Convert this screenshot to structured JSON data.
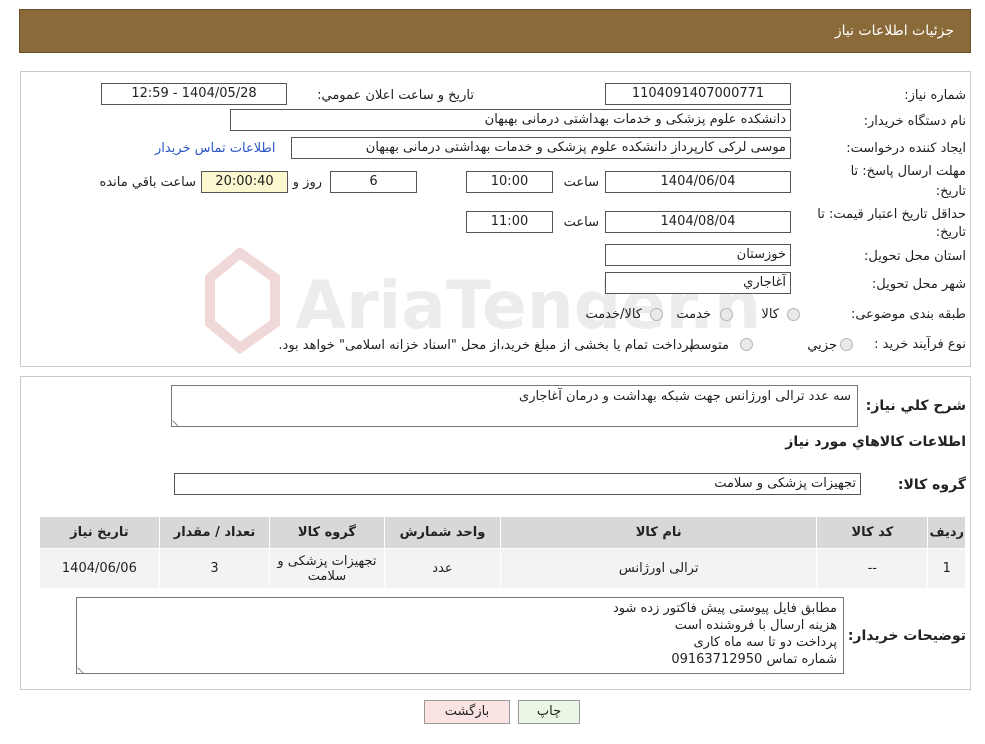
{
  "header": {
    "title": "جزئیات اطلاعات نیاز"
  },
  "info": {
    "need_number_label": "شماره نیاز:",
    "need_number": "1104091407000771",
    "announce_label": "تاريخ و ساعت اعلان عمومي:",
    "announce_value": "1404/05/28 - 12:59",
    "buyer_org_label": "نام دستگاه خريدار:",
    "buyer_org": "دانشکده علوم پزشکی و خدمات بهداشتی  درمانی بهبهان",
    "creator_label": "ايجاد کننده درخواست:",
    "creator": "موسی لرکی کارپرداز دانشکده علوم پزشکی و خدمات بهداشتی  درمانی بهبهان",
    "contact_link": "اطلاعات تماس خريدار",
    "reply_deadline_label_1": "مهلت ارسال پاسخ: تا",
    "reply_deadline_label_2": "تاريخ:",
    "reply_date": "1404/06/04",
    "time_label": "ساعت",
    "reply_time": "10:00",
    "days_value": "6",
    "days_label": "روز و",
    "remaining_time": "20:00:40",
    "remaining_label": "ساعت باقي مانده",
    "price_validity_label_1": "حداقل تاريخ اعتبار قيمت: تا",
    "price_validity_label_2": "تاريخ:",
    "price_date": "1404/08/04",
    "price_time": "11:00",
    "province_label": "استان محل تحويل:",
    "province": "خوزستان",
    "city_label": "شهر محل تحويل:",
    "city": "آغاجاري",
    "category_label": "طبقه بندی موضوعی:",
    "category_options": [
      "کالا",
      "خدمت",
      "کالا/خدمت"
    ],
    "process_label": "نوع فرآيند خريد :",
    "process_options": [
      "جزيي",
      "متوسط"
    ],
    "process_note": "پرداخت تمام يا بخشی از مبلغ خريد،از محل \"اسناد خزانه اسلامی\" خواهد بود."
  },
  "details": {
    "description_label": "شرح کلي نياز:",
    "description": "سه عدد ترالی اورژانس جهت شبکه بهداشت و درمان آغاجاری",
    "goods_info_title": "اطلاعات کالاهاي مورد نياز",
    "goods_group_label": "گروه کالا:",
    "goods_group": "تجهیزات پزشکی و سلامت",
    "table": {
      "headers": [
        "رديف",
        "کد کالا",
        "نام کالا",
        "واحد شمارش",
        "گروه کالا",
        "تعداد / مقدار",
        "تاريخ نياز"
      ],
      "rows": [
        [
          "1",
          "--",
          "ترالی اورژانس",
          "عدد",
          "تجهیزات پزشکی و سلامت",
          "3",
          "1404/06/06"
        ]
      ]
    },
    "buyer_notes_label": "توضيحات خريدار:",
    "buyer_notes": [
      "مطابق فایل پیوستی پیش فاکتور زده شود",
      "هزینه ارسال با فروشنده است",
      "پرداخت دو تا سه ماه کاری",
      "شماره تماس 09163712950"
    ]
  },
  "buttons": {
    "print": "چاپ",
    "back": "بازگشت"
  },
  "watermark": {
    "text": "AriaTender.neT"
  },
  "colors": {
    "header": "#8b6a3a",
    "link": "#2a55c8",
    "back_button": "#fbe3e3",
    "print_button": "#eaf7e4"
  }
}
